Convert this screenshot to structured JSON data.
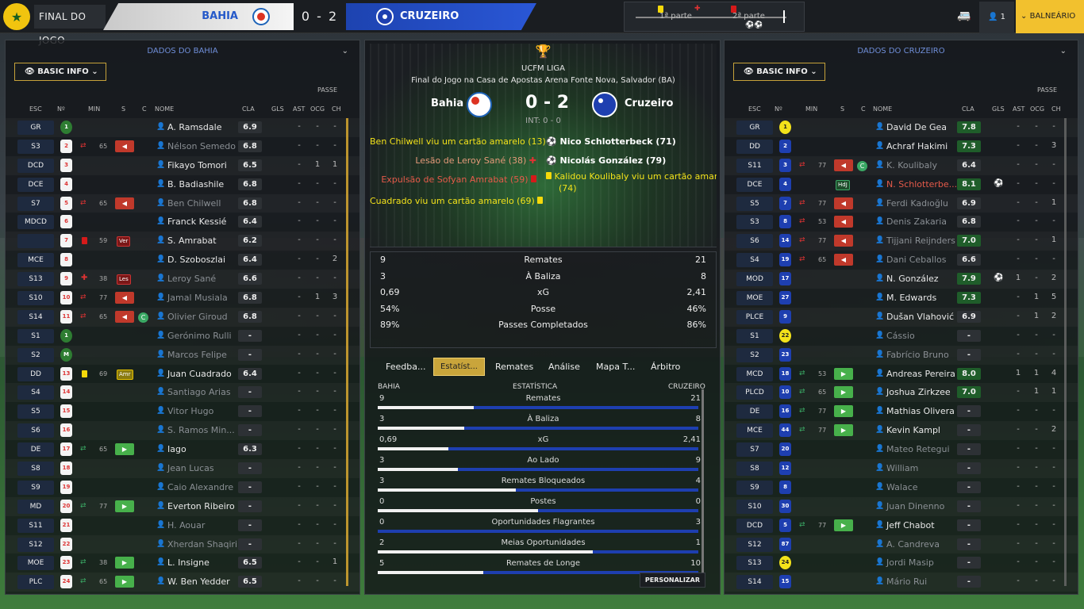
{
  "topbar": {
    "status": "FINAL DO JOGO",
    "home_team": "BAHIA",
    "away_team": "CRUZEIRO",
    "score": "0 - 2",
    "first_half": "1ª parte",
    "second_half": "2ª parte",
    "manager_count": "1",
    "balneario": "BALNEÁRIO"
  },
  "left": {
    "title": "DADOS DO BAHIA",
    "view_btn": "BASIC INFO",
    "passe_label": "PASSE",
    "headers": {
      "esc": "ESC",
      "num": "Nº",
      "min": "MIN",
      "s": "S",
      "c": "C",
      "nome": "NOME",
      "cla": "CLA",
      "gls": "GLS",
      "ast": "AST",
      "ocg": "OCG",
      "ch": "CH"
    },
    "rows": [
      {
        "pos": "GR",
        "num": "1",
        "shirt": "g",
        "name": "A. Ramsdale",
        "rating": "6.9",
        "gls": "",
        "ast": "-",
        "ocg": "-",
        "ch": "-"
      },
      {
        "pos": "S3",
        "num": "2",
        "shirt": "w",
        "min": "65",
        "sub": "out",
        "name": "Nélson Semedo",
        "dim": true,
        "rating": "6.8",
        "ast": "-",
        "ocg": "-",
        "ch": "-"
      },
      {
        "pos": "DCD",
        "num": "3",
        "shirt": "w",
        "name": "Fikayo Tomori",
        "rating": "6.5",
        "ast": "-",
        "ocg": "1",
        "ch": "1"
      },
      {
        "pos": "DCE",
        "num": "4",
        "shirt": "w",
        "name": "B. Badiashile",
        "rating": "6.8",
        "ast": "-",
        "ocg": "-",
        "ch": "-"
      },
      {
        "pos": "S7",
        "num": "5",
        "shirt": "w",
        "min": "65",
        "sub": "out",
        "name": "Ben Chilwell",
        "dim": true,
        "rating": "6.8",
        "ast": "-",
        "ocg": "-",
        "ch": "-"
      },
      {
        "pos": "MDCD",
        "num": "6",
        "shirt": "w",
        "name": "Franck Kessié",
        "rating": "6.4",
        "ast": "-",
        "ocg": "-",
        "ch": "-"
      },
      {
        "pos": "",
        "num": "7",
        "shirt": "w",
        "min": "59",
        "card": "red",
        "tag": "Ver",
        "name": "S. Amrabat",
        "rating": "6.2",
        "ast": "-",
        "ocg": "-",
        "ch": "-"
      },
      {
        "pos": "MCE",
        "num": "8",
        "shirt": "w",
        "name": "D. Szoboszlai",
        "rating": "6.4",
        "ast": "-",
        "ocg": "-",
        "ch": "2"
      },
      {
        "pos": "S13",
        "num": "9",
        "shirt": "w",
        "min": "38",
        "inj": true,
        "tag": "Les",
        "name": "Leroy Sané",
        "dim": true,
        "rating": "6.6",
        "ast": "-",
        "ocg": "-",
        "ch": "-"
      },
      {
        "pos": "S10",
        "num": "10",
        "shirt": "w",
        "min": "77",
        "sub": "out",
        "name": "Jamal Musiala",
        "dim": true,
        "rating": "6.8",
        "ast": "-",
        "ocg": "1",
        "ch": "3"
      },
      {
        "pos": "S14",
        "num": "11",
        "shirt": "w",
        "min": "65",
        "sub": "out",
        "cap": "C",
        "name": "Olivier Giroud",
        "dim": true,
        "rating": "6.8",
        "ast": "-",
        "ocg": "-",
        "ch": "-"
      },
      {
        "pos": "S1",
        "num": "1",
        "shirt": "g",
        "name": "Gerónimo Rulli",
        "dim": true,
        "rating": "-",
        "ast": "-",
        "ocg": "-",
        "ch": "-"
      },
      {
        "pos": "S2",
        "num": "M",
        "shirt": "g",
        "name": "Marcos Felipe",
        "dim": true,
        "rating": "-",
        "ast": "-",
        "ocg": "-",
        "ch": "-"
      },
      {
        "pos": "DD",
        "num": "13",
        "shirt": "w",
        "min": "69",
        "card": "yellow",
        "tag": "Amr",
        "name": "Juan Cuadrado",
        "rating": "6.4",
        "ast": "-",
        "ocg": "-",
        "ch": "-"
      },
      {
        "pos": "S4",
        "num": "14",
        "shirt": "w",
        "name": "Santiago Arias",
        "dim": true,
        "rating": "-",
        "ast": "-",
        "ocg": "-",
        "ch": "-"
      },
      {
        "pos": "S5",
        "num": "15",
        "shirt": "w",
        "name": "Vitor Hugo",
        "dim": true,
        "rating": "-",
        "ast": "-",
        "ocg": "-",
        "ch": "-"
      },
      {
        "pos": "S6",
        "num": "16",
        "shirt": "w",
        "name": "S. Ramos Min...",
        "dim": true,
        "rating": "-",
        "ast": "-",
        "ocg": "-",
        "ch": "-"
      },
      {
        "pos": "DE",
        "num": "17",
        "shirt": "w",
        "min": "65",
        "sub": "in",
        "name": "Iago",
        "rating": "6.3",
        "ast": "-",
        "ocg": "-",
        "ch": "-"
      },
      {
        "pos": "S8",
        "num": "18",
        "shirt": "w",
        "name": "Jean Lucas",
        "dim": true,
        "rating": "-",
        "ast": "-",
        "ocg": "-",
        "ch": "-"
      },
      {
        "pos": "S9",
        "num": "19",
        "shirt": "w",
        "name": "Caio Alexandre",
        "dim": true,
        "rating": "-",
        "ast": "-",
        "ocg": "-",
        "ch": "-"
      },
      {
        "pos": "MD",
        "num": "20",
        "shirt": "w",
        "min": "77",
        "sub": "in",
        "name": "Everton Ribeiro",
        "rating": "-",
        "ast": "-",
        "ocg": "-",
        "ch": "-"
      },
      {
        "pos": "S11",
        "num": "21",
        "shirt": "w",
        "name": "H. Aouar",
        "dim": true,
        "rating": "-",
        "ast": "-",
        "ocg": "-",
        "ch": "-"
      },
      {
        "pos": "S12",
        "num": "22",
        "shirt": "w",
        "name": "Xherdan Shaqiri",
        "dim": true,
        "rating": "-",
        "ast": "-",
        "ocg": "-",
        "ch": "-"
      },
      {
        "pos": "MOE",
        "num": "23",
        "shirt": "w",
        "min": "38",
        "sub": "in",
        "name": "L. Insigne",
        "rating": "6.5",
        "ast": "-",
        "ocg": "-",
        "ch": "1"
      },
      {
        "pos": "PLC",
        "num": "24",
        "shirt": "w",
        "min": "65",
        "sub": "in",
        "name": "W. Ben Yedder",
        "rating": "6.5",
        "ast": "-",
        "ocg": "-",
        "ch": "-"
      }
    ]
  },
  "center": {
    "league": "UCFM LIGA",
    "subtitle": "Final do Jogo na Casa de Apostas Arena Fonte Nova, Salvador (BA)",
    "home": "Bahia",
    "away": "Cruzeiro",
    "score": "0 - 2",
    "ht": "INT: 0 - 0",
    "events_home": [
      "Ben Chilwell viu um cartão amarelo (13)",
      "Lesão de Leroy Sané (38)",
      "Expulsão de Sofyan Amrabat (59)",
      "Cuadrado viu um cartão amarelo (69)"
    ],
    "events_away": [
      "Nico Schlotterbeck (71)",
      "Nicolás González (79)",
      "Kalidou Koulibaly viu um cartão amare",
      "(74)"
    ],
    "summary": [
      {
        "label": "Remates",
        "home": "9",
        "away": "21"
      },
      {
        "label": "À Baliza",
        "home": "3",
        "away": "8"
      },
      {
        "label": "xG",
        "home": "0,69",
        "away": "2,41"
      },
      {
        "label": "Posse",
        "home": "54%",
        "away": "46%"
      },
      {
        "label": "Passes Completados",
        "home": "89%",
        "away": "86%"
      }
    ],
    "tabs": [
      "Feedba...",
      "Estatíst...",
      "Remates",
      "Análise",
      "Mapa T...",
      "Árbitro"
    ],
    "detail_header": {
      "home": "BAHIA",
      "mid": "ESTATÍSTICA",
      "away": "CRUZEIRO"
    },
    "detail": [
      {
        "label": "Remates",
        "home": "9",
        "away": "21",
        "pct": 0.3
      },
      {
        "label": "À Baliza",
        "home": "3",
        "away": "8",
        "pct": 0.27
      },
      {
        "label": "xG",
        "home": "0,69",
        "away": "2,41",
        "pct": 0.22
      },
      {
        "label": "Ao Lado",
        "home": "3",
        "away": "9",
        "pct": 0.25
      },
      {
        "label": "Remates Bloqueados",
        "home": "3",
        "away": "4",
        "pct": 0.43
      },
      {
        "label": "Postes",
        "home": "0",
        "away": "0",
        "pct": 0.5
      },
      {
        "label": "Oportunidades Flagrantes",
        "home": "0",
        "away": "3",
        "pct": 0.0
      },
      {
        "label": "Meias Oportunidades",
        "home": "2",
        "away": "1",
        "pct": 0.67
      },
      {
        "label": "Remates de Longe",
        "home": "5",
        "away": "10",
        "pct": 0.33
      }
    ],
    "personalizar": "PERSONALIZAR"
  },
  "right": {
    "title": "DADOS DO CRUZEIRO",
    "view_btn": "BASIC INFO",
    "passe_label": "PASSE",
    "headers": {
      "esc": "ESC",
      "num": "Nº",
      "min": "MIN",
      "s": "S",
      "c": "C",
      "nome": "NOME",
      "cla": "CLA",
      "gls": "GLS",
      "ast": "AST",
      "ocg": "OCG",
      "ch": "CH"
    },
    "rows": [
      {
        "pos": "GR",
        "num": "1",
        "shirt": "y",
        "name": "David De Gea",
        "rating": "7.8",
        "hi": true,
        "ast": "-",
        "ocg": "-",
        "ch": "-"
      },
      {
        "pos": "DD",
        "num": "2",
        "shirt": "b",
        "name": "Achraf Hakimi",
        "rating": "7.3",
        "hi": true,
        "ast": "-",
        "ocg": "-",
        "ch": "3"
      },
      {
        "pos": "S11",
        "num": "3",
        "shirt": "b",
        "min": "77",
        "sub": "out",
        "cap": "C",
        "name": "K. Koulibaly",
        "dim": true,
        "rating": "6.4",
        "ast": "-",
        "ocg": "-",
        "ch": "-"
      },
      {
        "pos": "DCE",
        "num": "4",
        "shirt": "b",
        "tag": "HdJ",
        "name": "N. Schlotterbe...",
        "red": true,
        "rating": "8.1",
        "hi": true,
        "goal": true,
        "ast": "-",
        "ocg": "-",
        "ch": "-"
      },
      {
        "pos": "S5",
        "num": "7",
        "shirt": "b",
        "min": "77",
        "sub": "out",
        "name": "Ferdi Kadıoğlu",
        "dim": true,
        "rating": "6.9",
        "ast": "-",
        "ocg": "-",
        "ch": "1"
      },
      {
        "pos": "S3",
        "num": "8",
        "shirt": "b",
        "min": "53",
        "sub": "out",
        "name": "Denis Zakaria",
        "dim": true,
        "rating": "6.8",
        "ast": "-",
        "ocg": "-",
        "ch": "-"
      },
      {
        "pos": "S6",
        "num": "14",
        "shirt": "b",
        "min": "77",
        "sub": "out",
        "name": "Tijjani Reijnders",
        "dim": true,
        "rating": "7.0",
        "hi": true,
        "ast": "-",
        "ocg": "-",
        "ch": "1"
      },
      {
        "pos": "S4",
        "num": "19",
        "shirt": "b",
        "min": "65",
        "sub": "out",
        "name": "Dani Ceballos",
        "dim": true,
        "rating": "6.6",
        "ast": "-",
        "ocg": "-",
        "ch": "-"
      },
      {
        "pos": "MOD",
        "num": "17",
        "shirt": "b",
        "name": "N. González",
        "rating": "7.9",
        "hi": true,
        "goal": true,
        "ast": "1",
        "ocg": "-",
        "ch": "2"
      },
      {
        "pos": "MOE",
        "num": "27",
        "shirt": "b",
        "name": "M. Edwards",
        "rating": "7.3",
        "hi": true,
        "ast": "-",
        "ocg": "1",
        "ch": "5"
      },
      {
        "pos": "PLCE",
        "num": "9",
        "shirt": "b",
        "name": "Dušan Vlahović",
        "rating": "6.9",
        "ast": "-",
        "ocg": "1",
        "ch": "2"
      },
      {
        "pos": "S1",
        "num": "22",
        "shirt": "y",
        "name": "Cássio",
        "dim": true,
        "rating": "-",
        "ast": "-",
        "ocg": "-",
        "ch": "-"
      },
      {
        "pos": "S2",
        "num": "23",
        "shirt": "b",
        "name": "Fabrício Bruno",
        "dim": true,
        "rating": "-",
        "ast": "-",
        "ocg": "-",
        "ch": "-"
      },
      {
        "pos": "MCD",
        "num": "18",
        "shirt": "b",
        "min": "53",
        "sub": "in",
        "name": "Andreas Pereira",
        "rating": "8.0",
        "hi": true,
        "ast": "1",
        "ocg": "1",
        "ch": "4"
      },
      {
        "pos": "PLCD",
        "num": "10",
        "shirt": "b",
        "min": "65",
        "sub": "in",
        "name": "Joshua Zirkzee",
        "rating": "7.0",
        "hi": true,
        "ast": "-",
        "ocg": "1",
        "ch": "1"
      },
      {
        "pos": "DE",
        "num": "16",
        "shirt": "b",
        "min": "77",
        "sub": "in",
        "name": "Mathias Olivera",
        "rating": "-",
        "ast": "-",
        "ocg": "-",
        "ch": "-"
      },
      {
        "pos": "MCE",
        "num": "44",
        "shirt": "b",
        "min": "77",
        "sub": "in",
        "name": "Kevin Kampl",
        "rating": "-",
        "ast": "-",
        "ocg": "-",
        "ch": "2"
      },
      {
        "pos": "S7",
        "num": "20",
        "shirt": "b",
        "name": "Mateo Retegui",
        "dim": true,
        "rating": "-",
        "ast": "-",
        "ocg": "-",
        "ch": "-"
      },
      {
        "pos": "S8",
        "num": "12",
        "shirt": "b",
        "name": "William",
        "dim": true,
        "rating": "-",
        "ast": "-",
        "ocg": "-",
        "ch": "-"
      },
      {
        "pos": "S9",
        "num": "8",
        "shirt": "b",
        "name": "Walace",
        "dim": true,
        "rating": "-",
        "ast": "-",
        "ocg": "-",
        "ch": "-"
      },
      {
        "pos": "S10",
        "num": "30",
        "shirt": "b",
        "name": "Juan Dinenno",
        "dim": true,
        "rating": "-",
        "ast": "-",
        "ocg": "-",
        "ch": "-"
      },
      {
        "pos": "DCD",
        "num": "5",
        "shirt": "b",
        "min": "77",
        "sub": "in",
        "name": "Jeff Chabot",
        "rating": "-",
        "ast": "-",
        "ocg": "-",
        "ch": "-"
      },
      {
        "pos": "S12",
        "num": "87",
        "shirt": "b",
        "name": "A. Candreva",
        "dim": true,
        "rating": "-",
        "ast": "-",
        "ocg": "-",
        "ch": "-"
      },
      {
        "pos": "S13",
        "num": "24",
        "shirt": "y",
        "name": "Jordi Masip",
        "dim": true,
        "rating": "-",
        "ast": "-",
        "ocg": "-",
        "ch": "-"
      },
      {
        "pos": "S14",
        "num": "15",
        "shirt": "b",
        "name": "Mário Rui",
        "dim": true,
        "rating": "-",
        "ast": "-",
        "ocg": "-",
        "ch": "-"
      }
    ]
  },
  "colors": {
    "accent": "#c9a53b",
    "home": "#ffffff",
    "away": "#1e3fb0",
    "rating_high": "#1f5d2a"
  },
  "icons": [
    "trophy-icon",
    "eye-icon",
    "chevron-down-icon",
    "substitution-icon",
    "injury-icon",
    "card-icon",
    "goal-ball-icon",
    "person-icon",
    "van-icon"
  ]
}
